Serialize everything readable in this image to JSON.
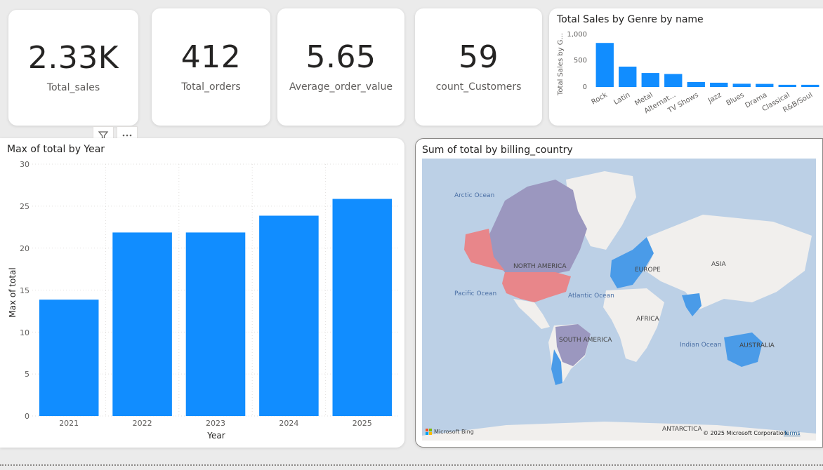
{
  "kpis": [
    {
      "value": "2.33K",
      "label": "Total_sales"
    },
    {
      "value": "412",
      "label": "Total_orders"
    },
    {
      "value": "5.65",
      "label": "Average_order_value"
    },
    {
      "value": "59",
      "label": "count_Customers"
    }
  ],
  "genre_chart": {
    "title": "Total Sales by Genre by name",
    "ylabel": "Total Sales by G...",
    "y_ticks": [
      "1,000",
      "500",
      "0"
    ]
  },
  "year_chart": {
    "title": "Max of total by Year",
    "xlabel": "Year",
    "ylabel": "Max of total",
    "y_ticks": [
      "30",
      "25",
      "20",
      "15",
      "10",
      "5",
      "0"
    ]
  },
  "map_visual": {
    "title": "Sum of total by billing_country",
    "labels": {
      "arctic": "Arctic Ocean",
      "pacific": "Pacific Ocean",
      "atlantic": "Atlantic Ocean",
      "indian": "Indian Ocean",
      "north_america": "NORTH AMERICA",
      "south_america": "SOUTH AMERICA",
      "europe": "EUROPE",
      "asia": "ASIA",
      "africa": "AFRICA",
      "australia": "AUSTRALIA",
      "antarctica": "ANTARCTICA"
    },
    "attribution": "Microsoft Bing",
    "copyright": "© 2025 Microsoft Corporation",
    "terms": "Terms",
    "colors": {
      "ocean": "#bcd0e6",
      "land": "#f1efed",
      "usa": "#e8868a",
      "canada": "#9b97bf",
      "highlight": "#4a9be8"
    }
  },
  "toolbar": {
    "filter_icon": "filter-icon",
    "more_icon": "more-options-icon"
  },
  "colors": {
    "bar": "#118dff"
  },
  "chart_data": [
    {
      "type": "bar",
      "title": "Total Sales by Genre by name",
      "xlabel": "",
      "ylabel": "Total Sales by G...",
      "categories": [
        "Rock",
        "Latin",
        "Metal",
        "Alternat...",
        "TV Shows",
        "Jazz",
        "Blues",
        "Drama",
        "Classical",
        "R&B/Soul"
      ],
      "values": [
        826,
        382,
        262,
        244,
        93,
        80,
        61,
        58,
        41,
        41
      ],
      "ylim": [
        0,
        1000
      ]
    },
    {
      "type": "bar",
      "title": "Max of total by Year",
      "xlabel": "Year",
      "ylabel": "Max of total",
      "categories": [
        "2021",
        "2022",
        "2023",
        "2024",
        "2025"
      ],
      "values": [
        13.86,
        21.86,
        21.86,
        23.86,
        25.86
      ],
      "ylim": [
        0,
        30
      ],
      "grid": true
    }
  ]
}
